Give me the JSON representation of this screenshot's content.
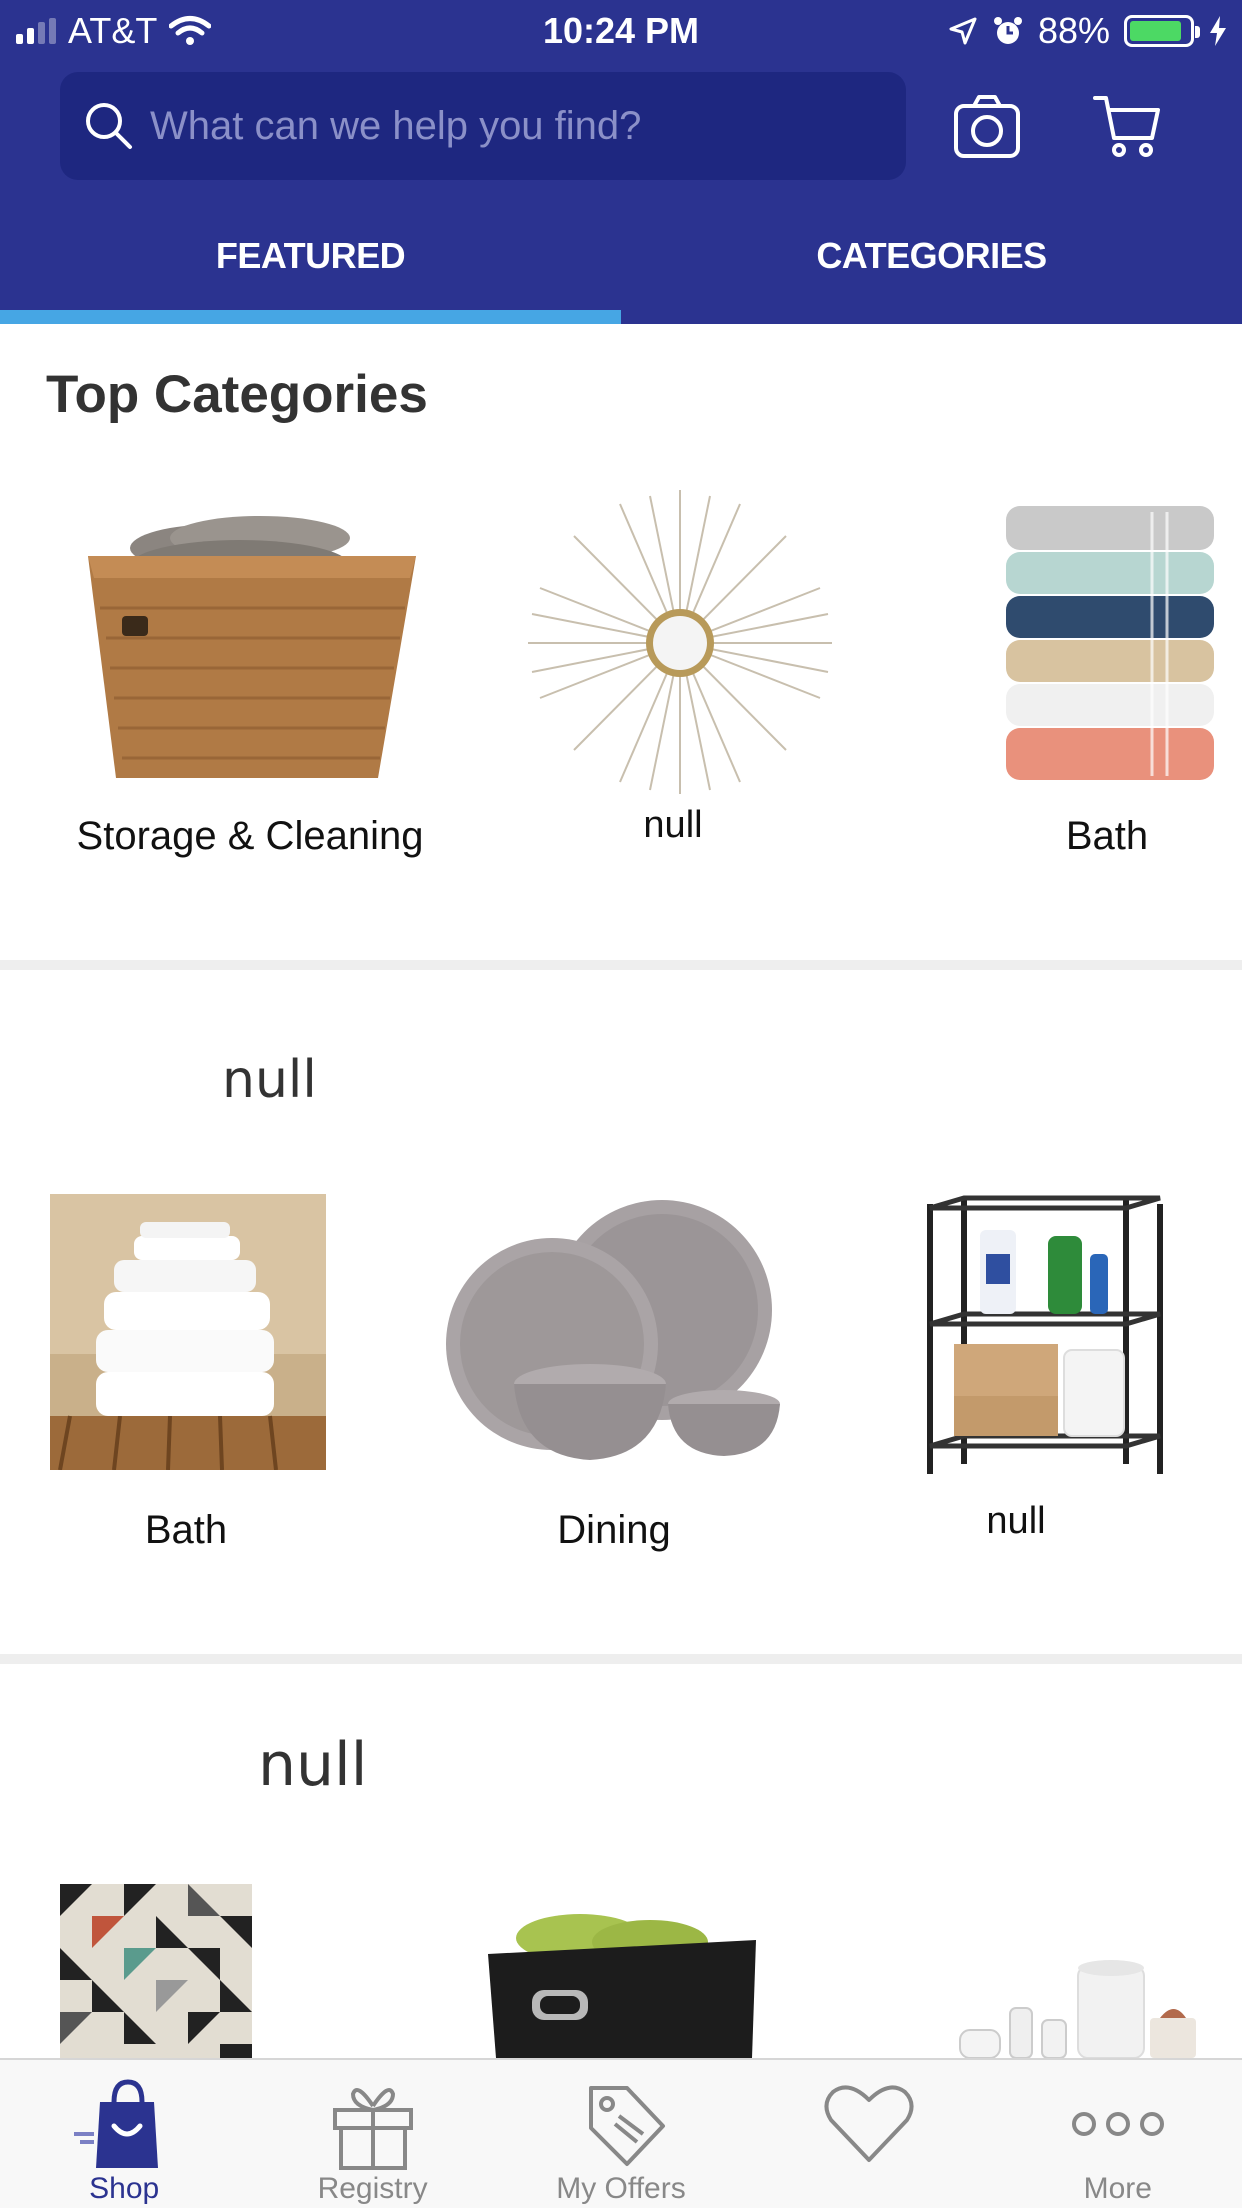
{
  "status_bar": {
    "carrier": "AT&T",
    "time": "10:24 PM",
    "battery": "88%",
    "battery_level": 0.88
  },
  "header": {
    "search_placeholder": "What can we help you find?",
    "tabs": [
      {
        "label": "FEATURED",
        "active": true
      },
      {
        "label": "CATEGORIES",
        "active": false
      }
    ]
  },
  "top_categories": {
    "title": "Top Categories",
    "items": [
      {
        "label": "Storage & Cleaning",
        "image": "woven-basket-with-towels"
      },
      {
        "label": "null",
        "image": "sunburst-mirror"
      },
      {
        "label": "Bath",
        "image": "stacked-colored-towels"
      }
    ]
  },
  "section_two": {
    "title": "null",
    "items": [
      {
        "label": "Bath",
        "image": "white-towels-on-bench"
      },
      {
        "label": "Dining",
        "image": "gray-dinnerware"
      },
      {
        "label": "null",
        "image": "wire-shelving-unit"
      }
    ]
  },
  "section_three": {
    "title": "null",
    "items": [
      {
        "image": "geometric-rug"
      },
      {
        "image": "black-storage-bin-green-towels"
      },
      {
        "image": "white-bath-accessories"
      }
    ]
  },
  "bottom_nav": [
    {
      "label": "Shop",
      "icon": "shopping-bag-icon",
      "active": true
    },
    {
      "label": "Registry",
      "icon": "gift-icon",
      "active": false
    },
    {
      "label": "My Offers",
      "icon": "tag-icon",
      "active": false
    },
    {
      "label": "",
      "icon": "heart-icon",
      "active": false
    },
    {
      "label": "More",
      "icon": "more-dots-icon",
      "active": false
    }
  ],
  "colors": {
    "header_bg": "#2b3390",
    "search_bg": "#1e2780",
    "tab_indicator": "#46a6e4",
    "battery_green": "#4cd964"
  }
}
